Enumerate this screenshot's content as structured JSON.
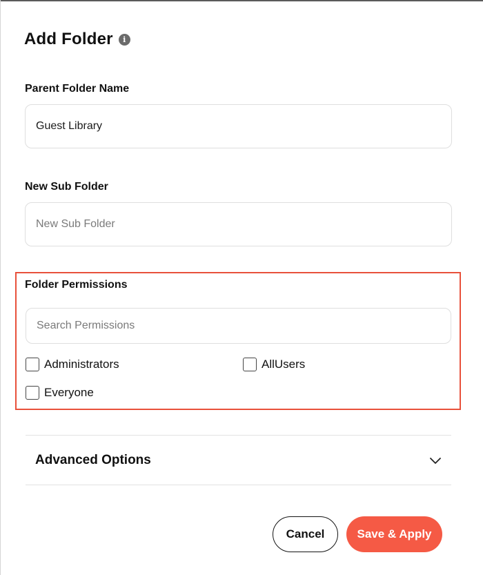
{
  "dialog": {
    "title": "Add Folder",
    "info_icon": "info-icon"
  },
  "parent_folder": {
    "label": "Parent Folder Name",
    "value": "Guest Library"
  },
  "sub_folder": {
    "label": "New Sub Folder",
    "placeholder": "New Sub Folder",
    "value": ""
  },
  "permissions": {
    "label": "Folder Permissions",
    "search_placeholder": "Search Permissions",
    "options": [
      {
        "label": "Administrators",
        "checked": false
      },
      {
        "label": "AllUsers",
        "checked": false
      },
      {
        "label": "Everyone",
        "checked": false
      }
    ],
    "highlight_color": "#e8503a"
  },
  "advanced": {
    "label": "Advanced Options",
    "icon": "chevron-down-icon"
  },
  "actions": {
    "cancel_label": "Cancel",
    "save_label": "Save & Apply",
    "save_color": "#f55a45"
  }
}
